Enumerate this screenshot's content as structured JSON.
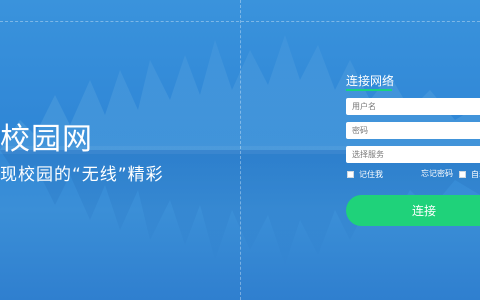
{
  "brand": {
    "title": "校园网",
    "subtitle": "现校园的“无线”精彩"
  },
  "login": {
    "title": "连接网络",
    "username_placeholder": "用户名",
    "password_placeholder": "密码",
    "service_placeholder": "选择服务",
    "remember_label": "记住我",
    "forgot_label": "忘记密码",
    "auto_label": "自动",
    "connect_label": "连接"
  },
  "colors": {
    "background": "#2f86d6",
    "accent": "#1fd27a"
  }
}
